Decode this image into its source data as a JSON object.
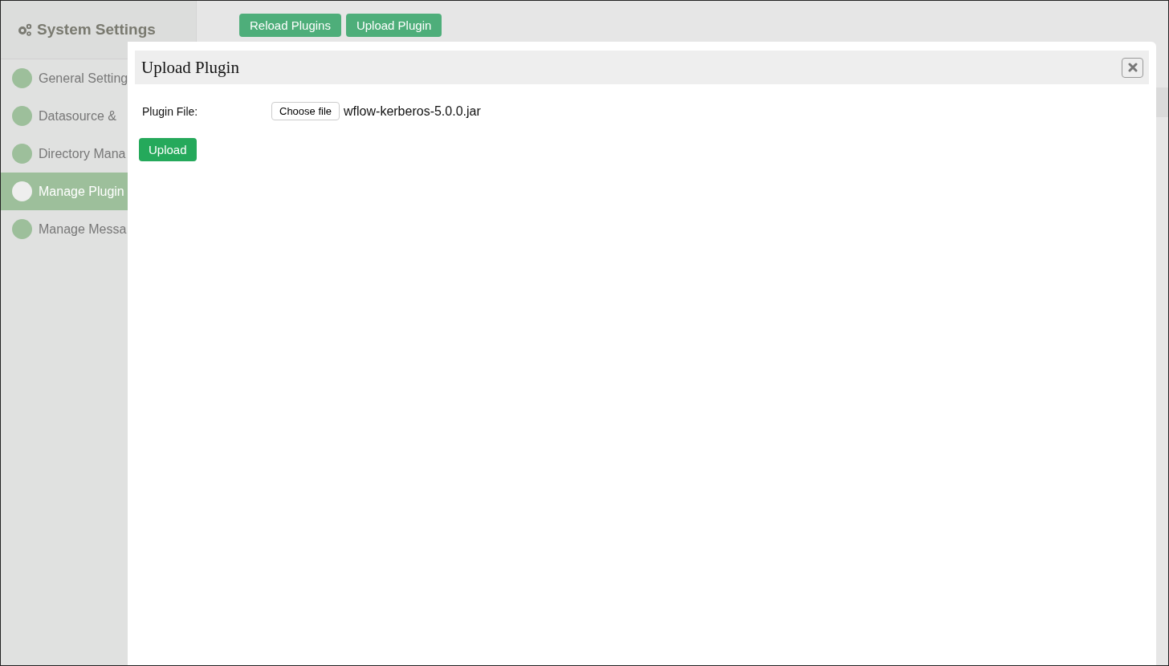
{
  "sidebar": {
    "title": "System Settings",
    "items": [
      {
        "label": "General Setting",
        "selected": false
      },
      {
        "label": "Datasource &",
        "selected": false
      },
      {
        "label": "Directory Mana",
        "selected": false
      },
      {
        "label": "Manage Plugin",
        "selected": true
      },
      {
        "label": "Manage Messa",
        "selected": false
      }
    ]
  },
  "toolbar": {
    "buttons": [
      "Reload Plugins",
      "Upload Plugin"
    ]
  },
  "dialog": {
    "title": "Upload Plugin",
    "field_label": "Plugin File:",
    "choose_button": "Choose file",
    "file_name": "wflow-kerberos-5.0.0.jar",
    "submit": "Upload"
  }
}
